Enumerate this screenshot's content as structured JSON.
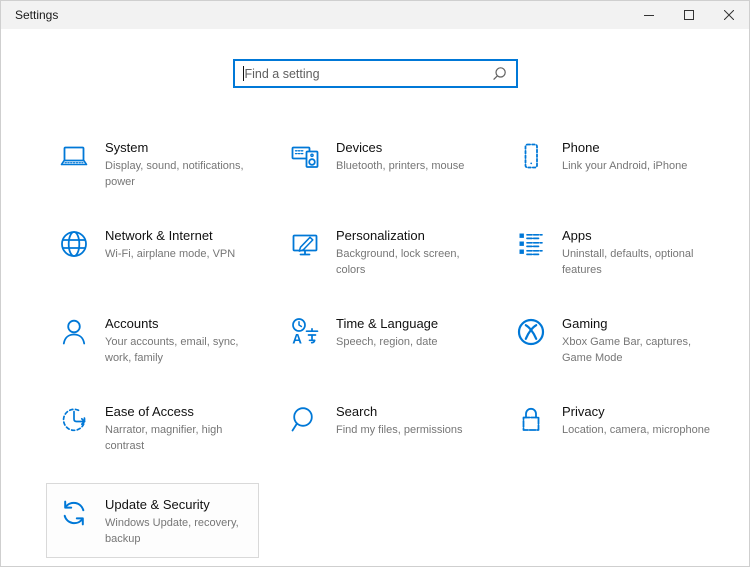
{
  "window": {
    "title": "Settings",
    "controls": [
      "minimize",
      "maximize",
      "close"
    ]
  },
  "search": {
    "placeholder": "Find a setting"
  },
  "accent_color": "#0078d7",
  "tiles": [
    {
      "icon": "laptop-icon",
      "title": "System",
      "subtitle": "Display, sound, notifications, power"
    },
    {
      "icon": "devices-icon",
      "title": "Devices",
      "subtitle": "Bluetooth, printers, mouse"
    },
    {
      "icon": "phone-icon",
      "title": "Phone",
      "subtitle": "Link your Android, iPhone"
    },
    {
      "icon": "globe-icon",
      "title": "Network & Internet",
      "subtitle": "Wi-Fi, airplane mode, VPN"
    },
    {
      "icon": "personalization-icon",
      "title": "Personalization",
      "subtitle": "Background, lock screen, colors"
    },
    {
      "icon": "apps-icon",
      "title": "Apps",
      "subtitle": "Uninstall, defaults, optional features"
    },
    {
      "icon": "accounts-icon",
      "title": "Accounts",
      "subtitle": "Your accounts, email, sync, work, family"
    },
    {
      "icon": "time-language-icon",
      "title": "Time & Language",
      "subtitle": "Speech, region, date"
    },
    {
      "icon": "gaming-icon",
      "title": "Gaming",
      "subtitle": "Xbox Game Bar, captures, Game Mode"
    },
    {
      "icon": "ease-of-access-icon",
      "title": "Ease of Access",
      "subtitle": "Narrator, magnifier, high contrast"
    },
    {
      "icon": "search-icon",
      "title": "Search",
      "subtitle": "Find my files, permissions"
    },
    {
      "icon": "privacy-icon",
      "title": "Privacy",
      "subtitle": "Location, camera, microphone"
    },
    {
      "icon": "sync-icon",
      "title": "Update & Security",
      "subtitle": "Windows Update, recovery, backup",
      "highlighted": true
    }
  ]
}
